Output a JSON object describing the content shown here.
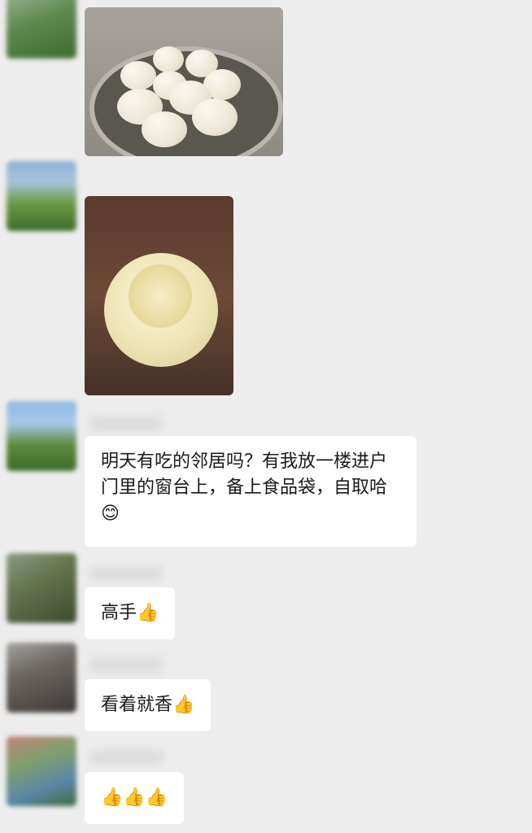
{
  "messages": [
    {
      "type": "image",
      "alt": "steamer-with-buns"
    },
    {
      "type": "image",
      "alt": "bitten-bun"
    },
    {
      "type": "text",
      "text": "明天有吃的邻居吗？有我放一楼进户门里的窗台上，备上食品袋，自取哈😊"
    },
    {
      "type": "text",
      "text": "高手👍"
    },
    {
      "type": "text",
      "text": "看着就香👍"
    },
    {
      "type": "text",
      "text": "👍👍👍"
    }
  ],
  "colors": {
    "background": "#ededed",
    "bubble": "#ffffff",
    "text": "#191919"
  }
}
